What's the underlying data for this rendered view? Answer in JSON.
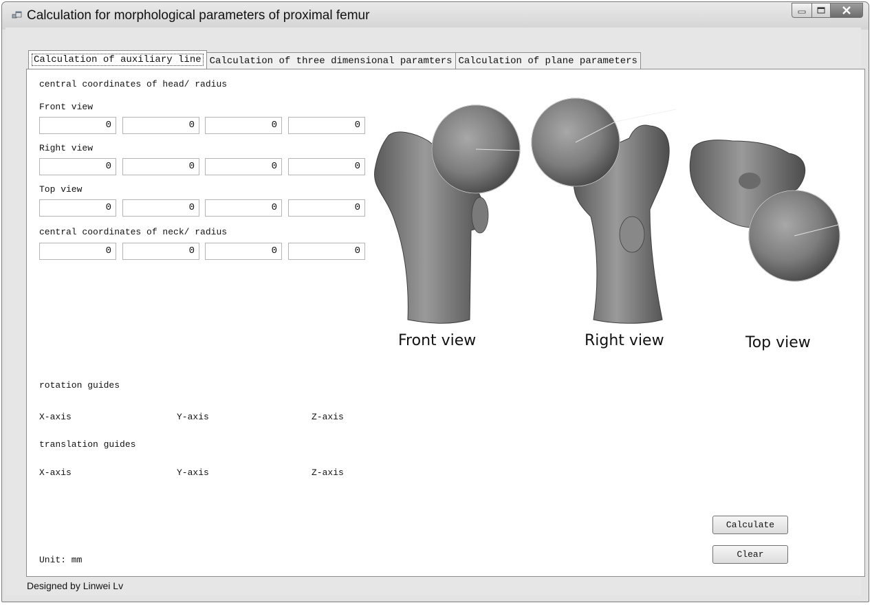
{
  "window": {
    "title": "Calculation for morphological parameters of proximal femur",
    "icons": [
      "app-icon",
      "minimize-icon",
      "maximize-icon",
      "close-icon"
    ]
  },
  "tabs": [
    {
      "label": "Calculation of auxiliary line",
      "active": true
    },
    {
      "label": "Calculation of three dimensional paramters",
      "active": false
    },
    {
      "label": "Calculation of plane parameters",
      "active": false
    }
  ],
  "head_section": {
    "title": "central coordinates of head/ radius",
    "front": {
      "label": "Front view",
      "values": [
        "0",
        "0",
        "0",
        "0"
      ]
    },
    "right": {
      "label": "Right view",
      "values": [
        "0",
        "0",
        "0",
        "0"
      ]
    },
    "top": {
      "label": "Top view",
      "values": [
        "0",
        "0",
        "0",
        "0"
      ]
    }
  },
  "neck_section": {
    "title": "central coordinates of neck/ radius",
    "values": [
      "0",
      "0",
      "0",
      "0"
    ]
  },
  "figure": {
    "front_caption": "Front view",
    "right_caption": "Right view",
    "top_caption": "Top view"
  },
  "rotation": {
    "title": "rotation guides",
    "x": "X-axis",
    "y": "Y-axis",
    "z": "Z-axis"
  },
  "translation": {
    "title": "translation guides",
    "x": "X-axis",
    "y": "Y-axis",
    "z": "Z-axis"
  },
  "unit": "Unit: mm",
  "buttons": {
    "calculate": "Calculate",
    "clear": "Clear"
  },
  "footer": "Designed by Linwei Lv"
}
